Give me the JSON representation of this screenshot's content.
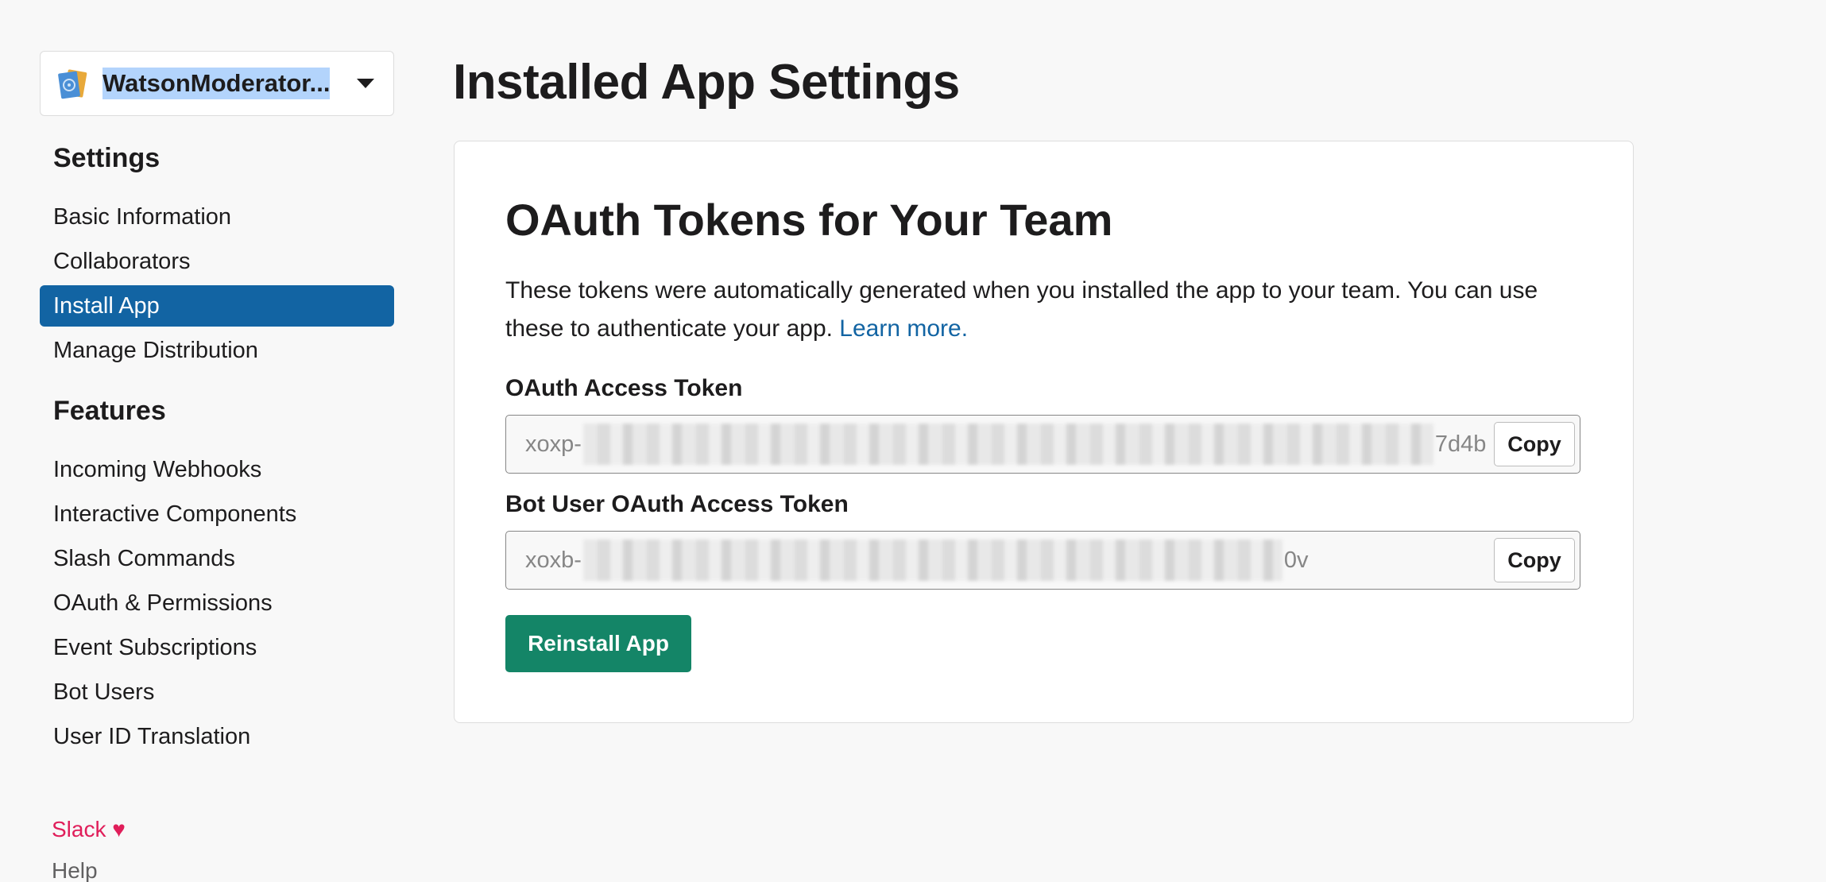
{
  "app": {
    "name": "WatsonModerator...",
    "icon": "app-book-icon"
  },
  "sidebar": {
    "settings_heading": "Settings",
    "settings_items": [
      {
        "label": "Basic Information",
        "active": false
      },
      {
        "label": "Collaborators",
        "active": false
      },
      {
        "label": "Install App",
        "active": true
      },
      {
        "label": "Manage Distribution",
        "active": false
      }
    ],
    "features_heading": "Features",
    "features_items": [
      {
        "label": "Incoming Webhooks"
      },
      {
        "label": "Interactive Components"
      },
      {
        "label": "Slash Commands"
      },
      {
        "label": "OAuth & Permissions"
      },
      {
        "label": "Event Subscriptions"
      },
      {
        "label": "Bot Users"
      },
      {
        "label": "User ID Translation"
      }
    ],
    "footer": {
      "slack_label": "Slack",
      "heart": "♥",
      "help_label": "Help"
    }
  },
  "main": {
    "page_title": "Installed App Settings",
    "card": {
      "title": "OAuth Tokens for Your Team",
      "description": "These tokens were automatically generated when you installed the app to your team. You can use these to authenticate your app. ",
      "learn_more": "Learn more.",
      "oauth_token": {
        "label": "OAuth Access Token",
        "prefix": "xoxp-",
        "suffix": "7d4b",
        "copy_label": "Copy"
      },
      "bot_token": {
        "label": "Bot User OAuth Access Token",
        "prefix": "xoxb-",
        "suffix": "0v",
        "copy_label": "Copy"
      },
      "reinstall_label": "Reinstall App"
    }
  },
  "colors": {
    "active_nav": "#1264a3",
    "link": "#1264a3",
    "reinstall_button": "#148567",
    "slack_footer": "#e01e5a"
  }
}
